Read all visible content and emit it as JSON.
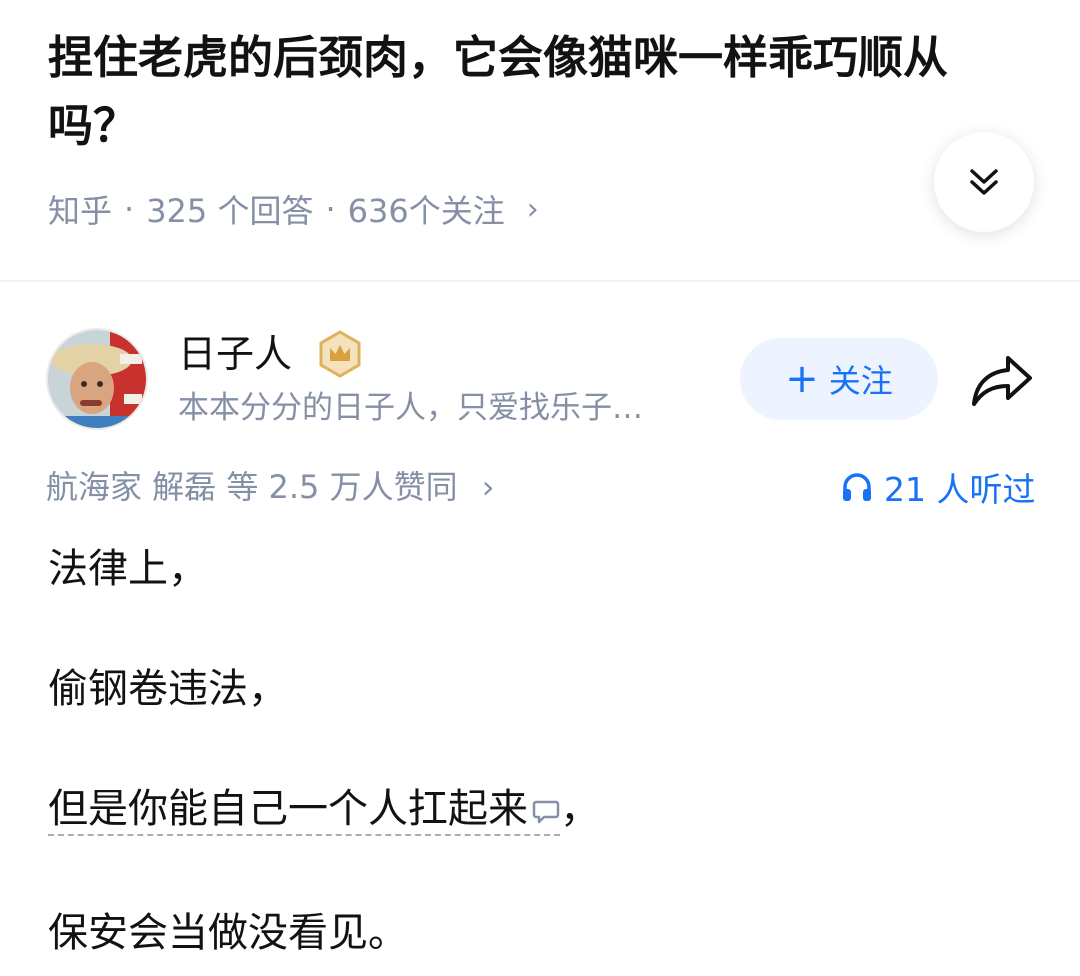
{
  "question": {
    "title": "捏住老虎的后颈肉，它会像猫咪一样乖巧顺从吗？",
    "source": "知乎",
    "answers": "325 个回答",
    "follows": "636个关注",
    "chevron": "›"
  },
  "author": {
    "name": "日子人",
    "bio": "本本分分的日子人，只爱找乐子…",
    "follow_label": "关注",
    "follow_plus": "+"
  },
  "engagement": {
    "upvoters": "航海家 解磊 等 2.5 万人赞同",
    "chevron": "›",
    "listeners": "21 人听过"
  },
  "answer": {
    "paragraphs": [
      "法律上，",
      "偷钢卷违法，",
      "但是你能自己一个人扛起来",
      "，",
      "保安会当做没看见。"
    ]
  },
  "icons": {
    "expand": "double-chevron-down-icon",
    "share": "share-arrow-icon",
    "headphones": "headphones-icon",
    "crown": "crown-badge-icon",
    "comment": "comment-bubble-icon"
  },
  "colors": {
    "accent": "#1772f6",
    "muted": "#8590a6",
    "text": "#121212",
    "follow_bg": "#eef4ff",
    "badge_gold": "#e0b15a"
  }
}
